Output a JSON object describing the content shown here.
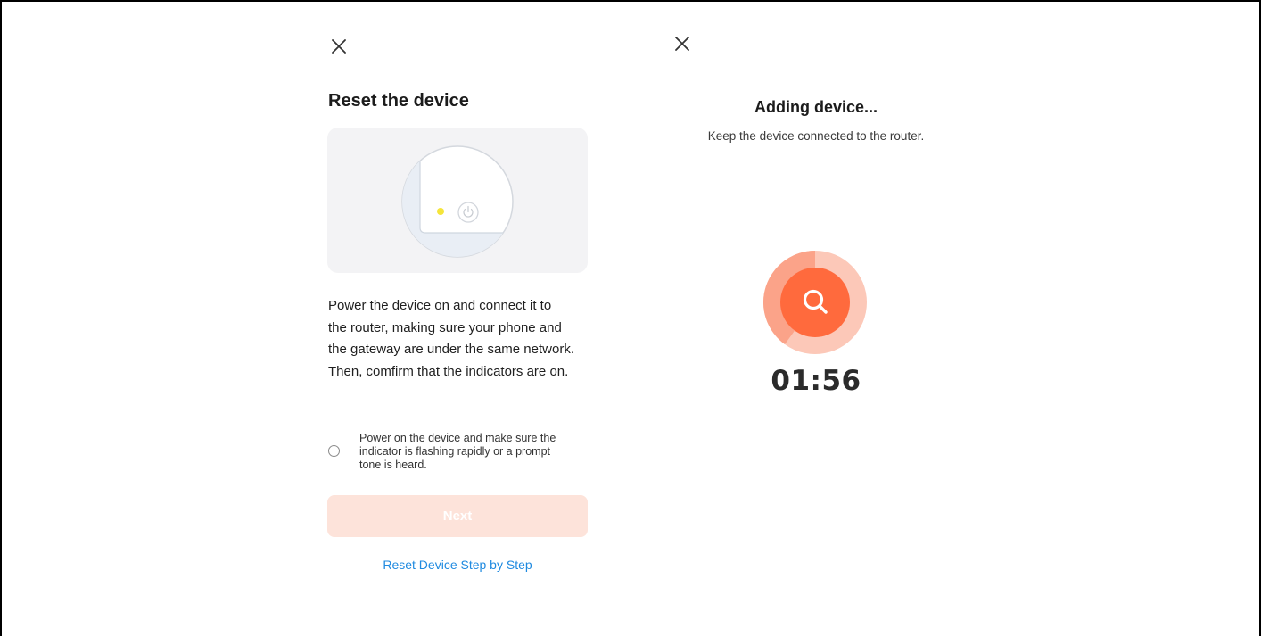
{
  "left_panel": {
    "close_icon": "close-icon",
    "title": "Reset the device",
    "illustration": {
      "indicator_color": "#f5e53a",
      "power_icon": "power-icon"
    },
    "description_lines": [
      "Power the device on and connect it to",
      "the router, making sure your phone and",
      "the gateway are under the same network.",
      "Then, comfirm that the indicators are on."
    ],
    "confirm": {
      "checked": false,
      "lines": [
        "Power on the device and make sure the",
        "indicator is flashing rapidly or a prompt",
        "tone is heard."
      ]
    },
    "next_label": "Next",
    "reset_link": "Reset Device Step by Step"
  },
  "right_panel": {
    "close_icon": "close-icon",
    "title": "Adding device...",
    "subtitle": "Keep the device connected to the router.",
    "search_icon": "search-icon",
    "timer": "01:56"
  },
  "colors": {
    "accent": "#ff6a3d",
    "accent_light": "#fde3da",
    "link": "#1f8ae0"
  }
}
